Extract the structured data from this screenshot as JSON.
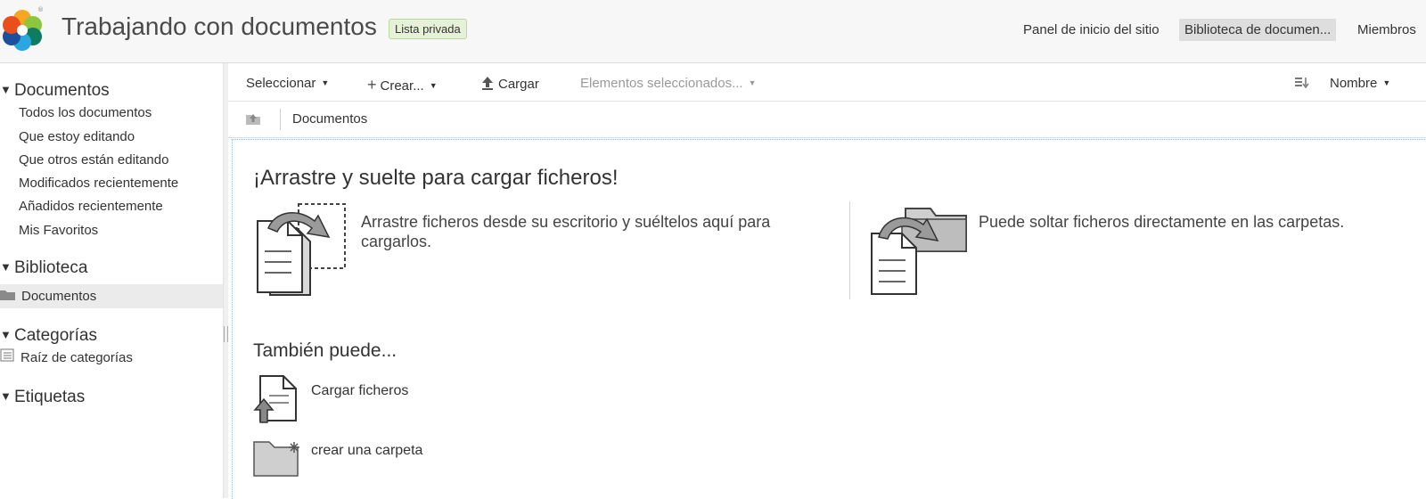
{
  "header": {
    "site_title": "Trabajando con documentos",
    "visibility_badge": "Lista privada",
    "nav": {
      "dashboard": "Panel de inicio del sitio",
      "library": "Biblioteca de documen...",
      "members": "Miembros"
    }
  },
  "sidebar": {
    "documents_heading": "Documentos",
    "documents_items": [
      "Todos los documentos",
      "Que estoy editando",
      "Que otros están editando",
      "Modificados recientemente",
      "Añadidos recientemente",
      "Mis Favoritos"
    ],
    "library_heading": "Biblioteca",
    "library_folder": "Documentos",
    "categories_heading": "Categorías",
    "categories_root": "Raíz de categorías",
    "tags_heading": "Etiquetas"
  },
  "toolbar": {
    "select": "Seleccionar",
    "create": "Crear...",
    "upload": "Cargar",
    "selected_items": "Elementos seleccionados...",
    "sort_field": "Nombre"
  },
  "breadcrumb": {
    "current": "Documentos"
  },
  "main": {
    "dnd_title": "¡Arrastre y suelte para cargar ficheros!",
    "dnd_desktop_text": "Arrastre ficheros desde su escritorio y suéltelos aquí para cargarlos.",
    "dnd_folders_text": "Puede soltar ficheros directamente en las carpetas.",
    "also_title": "También puede...",
    "upload_files": "Cargar ficheros",
    "create_folder": "crear una carpeta"
  },
  "colors": {
    "badge_bg": "#e6f2d8",
    "active_nav_bg": "#dedede",
    "selected_row_bg": "#ebebeb",
    "dropzone_border": "#8fb7d5"
  }
}
